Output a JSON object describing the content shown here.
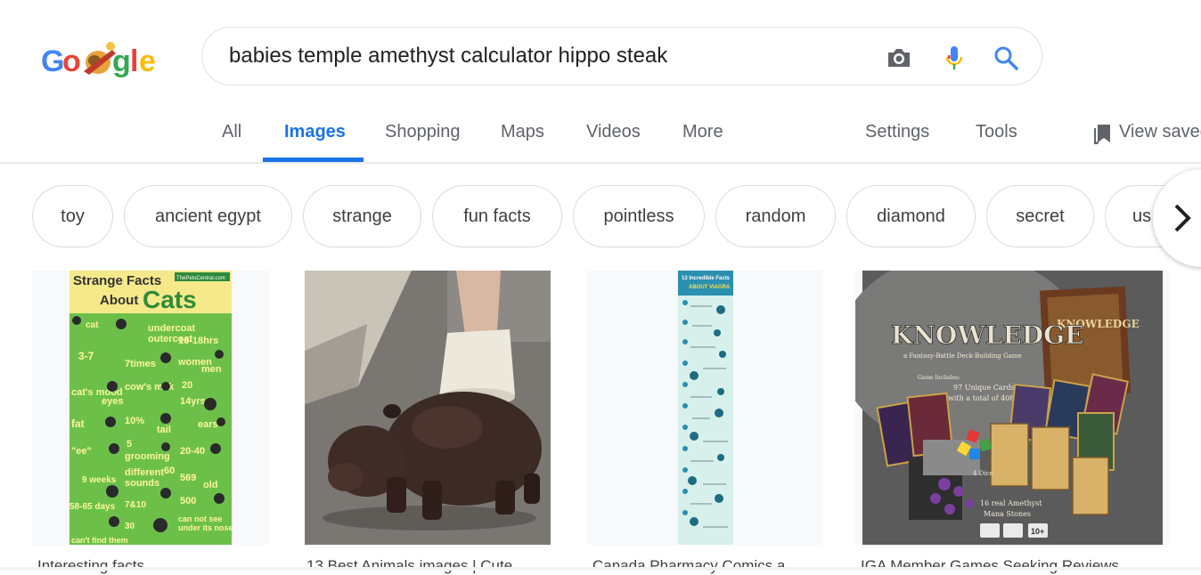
{
  "logo": {
    "text": "Google"
  },
  "search": {
    "query": "babies temple amethyst calculator hippo steak",
    "icons": [
      "camera-icon",
      "microphone-icon",
      "search-icon"
    ]
  },
  "tabs": [
    {
      "label": "All"
    },
    {
      "label": "Images",
      "active": true
    },
    {
      "label": "Shopping"
    },
    {
      "label": "Maps"
    },
    {
      "label": "Videos"
    },
    {
      "label": "More"
    },
    {
      "label": "Settings"
    },
    {
      "label": "Tools"
    }
  ],
  "view_saved": {
    "label": "View saved",
    "icon": "bookmarks-icon"
  },
  "chips": [
    "toy",
    "ancient egypt",
    "strange",
    "fun facts",
    "pointless",
    "random",
    "diamond",
    "secret",
    "us"
  ],
  "results": [
    {
      "caption": "Interesting facts ...",
      "image": {
        "title_line1": "Strange Facts",
        "title_line2": "About",
        "title_cats": "Cats",
        "badge": "ThePetsCentral.com",
        "facts": [
          "cat",
          "undercoat",
          "outercoat",
          "16-18hrs",
          "3-7",
          "7times",
          "women",
          "men",
          "cat's mood",
          "cow's milk",
          "20",
          "eyes",
          "14yrs",
          "fat",
          "10%",
          "tail",
          "ears",
          "\"ee\"",
          "5",
          "grooming",
          "20-40",
          "9 weeks",
          "different",
          "60",
          "sounds",
          "569",
          "old",
          "58-65 days",
          "7&10",
          "500",
          "30",
          "can not see",
          "can't find them",
          "under its nose"
        ]
      }
    },
    {
      "caption": "13 Best Animals images | Cute ..."
    },
    {
      "caption": "Canada Pharmacy Comics a ...",
      "image": {
        "header": "13 Incredible Facts",
        "sub": "ABOUT VIAGRA"
      }
    },
    {
      "caption": "IGA Member Games Seeking Reviews ...",
      "image": {
        "title": "KNOWLEDGE",
        "subtitle": "a Fantasy-Battle Deck-Building Game",
        "includes": "Game Includes:",
        "cards1": "97 Unique Cards",
        "cards2": "with a total of 408 Cards",
        "dice": "4 Dice",
        "stones1": "16 real Amethyst",
        "stones2": "Mana Stones",
        "badge": "10+",
        "book": "KNOWLEDGE"
      }
    }
  ],
  "colors": {
    "accent": "#1a73e8",
    "tab_gray": "#5f6368",
    "border": "#dfe1e5",
    "infographic_green": "#5cb85c",
    "infographic_teal": "#b9e6e2"
  }
}
